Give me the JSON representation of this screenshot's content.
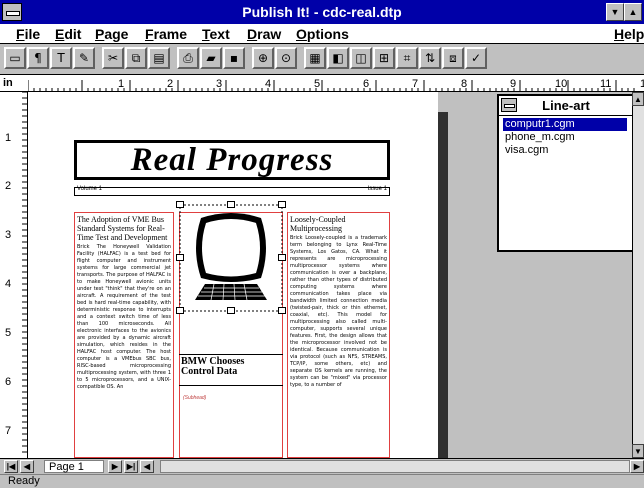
{
  "window": {
    "title": "Publish It! - cdc-real.dtp"
  },
  "menubar": {
    "items": [
      "File",
      "Edit",
      "Page",
      "Frame",
      "Text",
      "Draw",
      "Options"
    ],
    "help": "Help"
  },
  "ruler": {
    "unit": "in",
    "h_numbers": [
      "1",
      "2",
      "3",
      "4",
      "5",
      "6",
      "7",
      "8",
      "9",
      "10",
      "11",
      "12"
    ],
    "v_numbers": [
      "1",
      "2",
      "3",
      "4",
      "5",
      "6",
      "7"
    ]
  },
  "document": {
    "masthead": "Real Progress",
    "volume": "Volume 1",
    "issue": "Issue 1",
    "article1": {
      "title": "The Adoption of VME Bus Standard Systems for Real-Time Test and Development",
      "body": "Brick The Honeywell Validation Facility (HALFAC) is a test bed for flight computer and instrument systems for large commercial jet transports. The purpose of HALFAC is to make Honeywell avionic units under test \"think\" that they're on an aircraft. A requirement of the test bed is hard real-time capability, with deterministic response to interrupts and a context switch time of less than 100 microseconds. All electronic interfaces to the avionics are provided by a dynamic aircraft simulation, which resides in the HALFAC host computer. The host computer is a VMEbus SBC bus, RISC-based microprocessing multiprocessing system, with three 1 to 5 microprocessors, and a UNIX-compatible OS. An"
    },
    "article2": {
      "title": "BMW Chooses Control Data",
      "subhead": "(Subhead)"
    },
    "article3": {
      "title": "Loosely-Coupled Multiprocessing",
      "body": "Brick Loosely-coupled is a trademark term belonging to Lynx Real-Time Systems, Los Gatos, CA. What it represents are microprocessing multiprocessor systems where communication is over a backplane, rather than other types of distributed computing systems where communication takes place via bandwidth limited connection media (twisted-pair, thick or thin ethernet, coaxial, etc). This model for multiprocessing also called multi-computer, supports several unique features. First, the design allows that the microprocessor involved not be identical. Because communication is via protocol (such as NFS, STREAMS, TCP/IP, some others, etc) and separate OS kernels are running, the system can be \"mixed\" via processor type, to a number of"
    }
  },
  "lineart": {
    "title": "Line-art",
    "files": [
      "computr1.cgm",
      "phone_m.cgm",
      "visa.cgm"
    ],
    "selected": 0
  },
  "navigation": {
    "page_label": "Page 1"
  },
  "status": {
    "text": "Ready"
  }
}
